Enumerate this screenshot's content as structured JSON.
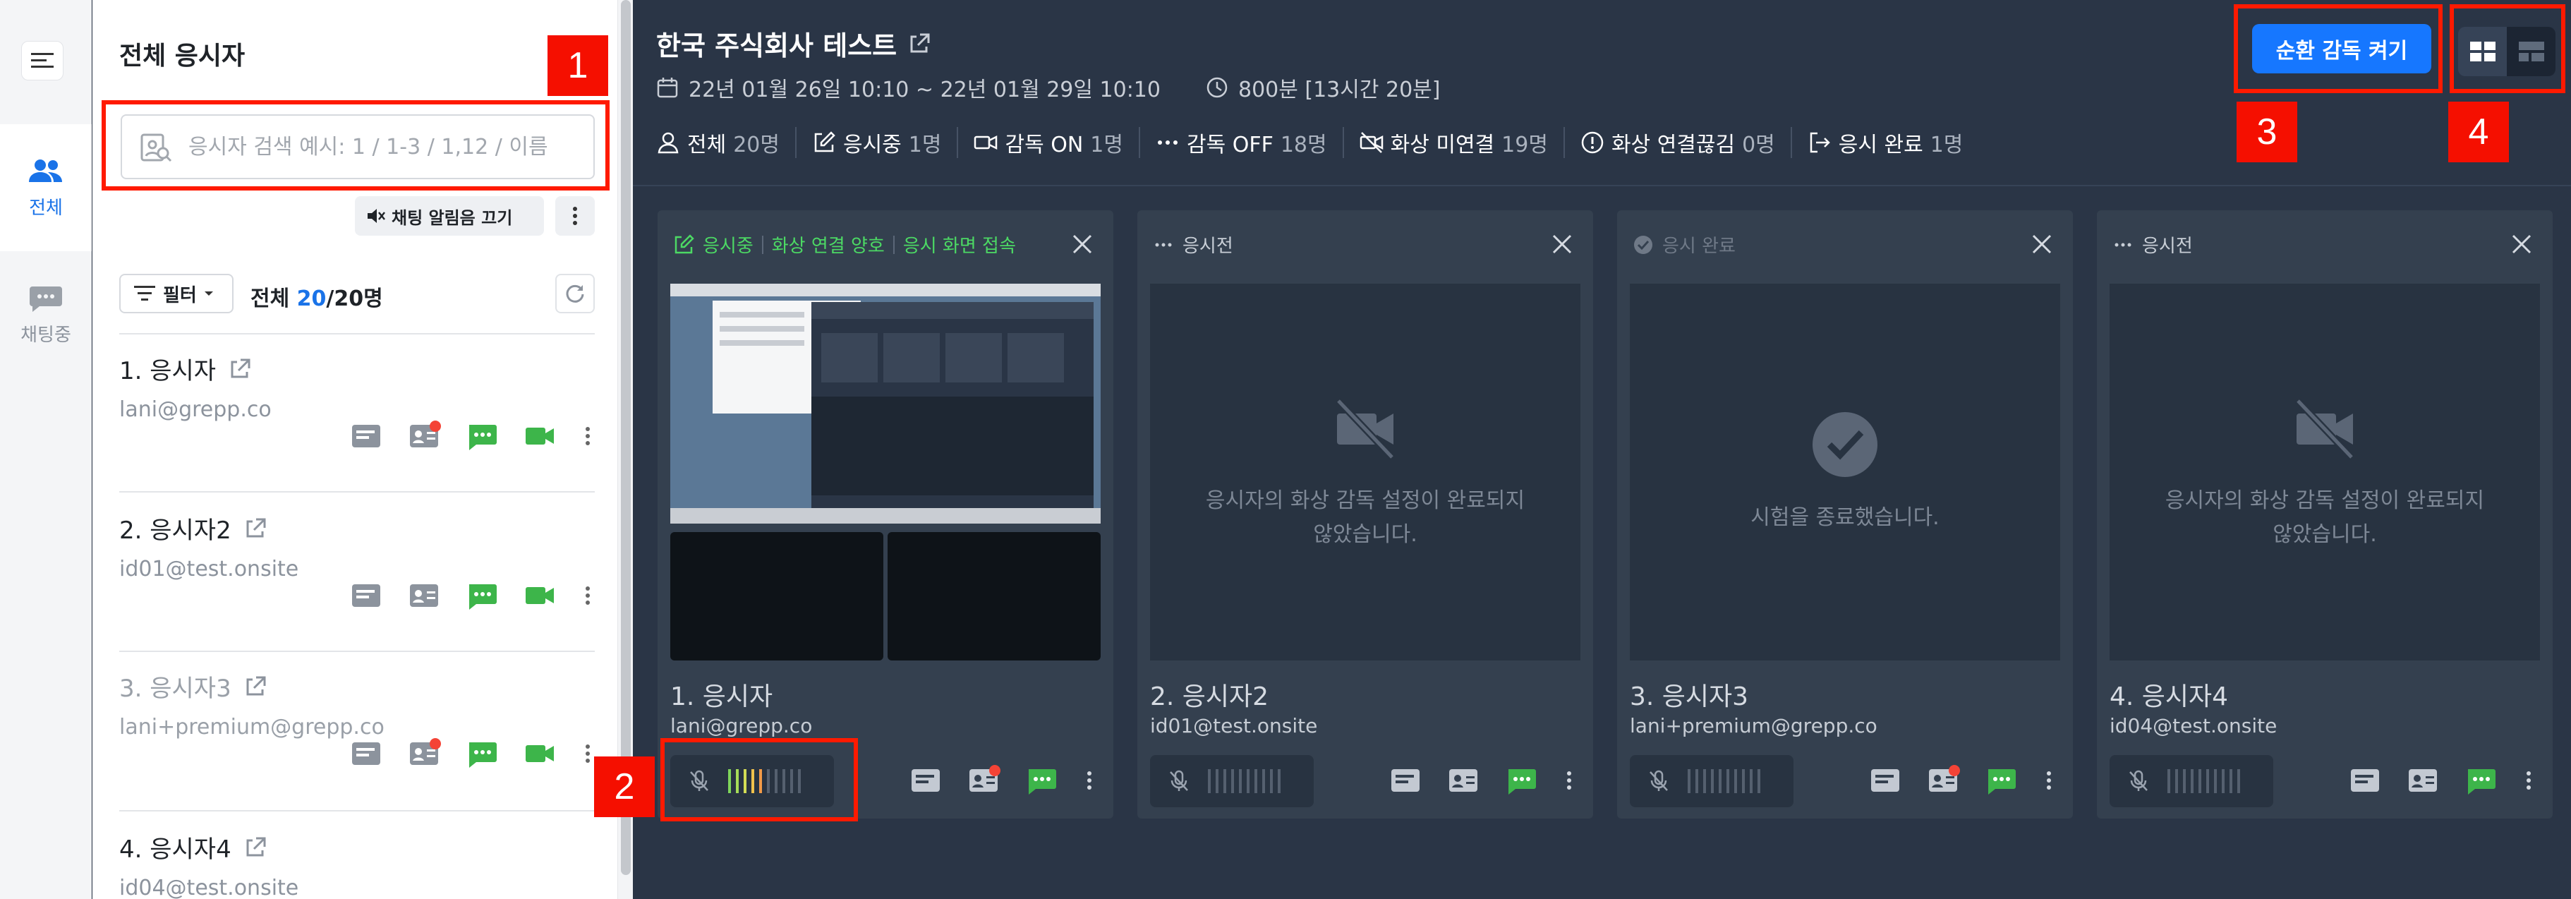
{
  "rail": {
    "tab_all": "전체",
    "tab_chat": "채팅중"
  },
  "panel": {
    "title": "전체 응시자",
    "search_placeholder": "응시자 검색 예시: 1 / 1-3 / 1,12 / 이름",
    "mute_label": "채팅 알림음 끄기",
    "filter_label": "필터",
    "count_prefix": "전체",
    "count_current": "20",
    "count_total": "/20명"
  },
  "participants": [
    {
      "name": "1. 응시자",
      "email": "lani@grepp.co"
    },
    {
      "name": "2. 응시자2",
      "email": "id01@test.onsite"
    },
    {
      "name": "3. 응시자3",
      "email": "lani+premium@grepp.co"
    },
    {
      "name": "4. 응시자4",
      "email": "id04@test.onsite"
    }
  ],
  "header": {
    "title": "한국 주식회사 테스트",
    "period": "22년 01월 26일 10:10 ~ 22년 01월 29일 10:10",
    "duration": "800분 [13시간 20분]",
    "rotate_button": "순환 감독 켜기"
  },
  "stats": [
    {
      "label": "전체",
      "value": "20명",
      "icon": "person-icon"
    },
    {
      "label": "응시중",
      "value": "1명",
      "icon": "edit-icon"
    },
    {
      "label": "감독 ON",
      "value": "1명",
      "icon": "video-icon"
    },
    {
      "label": "감독 OFF",
      "value": "18명",
      "icon": "ellipsis-icon"
    },
    {
      "label": "화상 미연결",
      "value": "19명",
      "icon": "video-off-icon"
    },
    {
      "label": "화상 연결끊김",
      "value": "0명",
      "icon": "alert-icon"
    },
    {
      "label": "응시 완료",
      "value": "1명",
      "icon": "exit-icon"
    }
  ],
  "cards": [
    {
      "status_1": "응시중",
      "status_2": "화상 연결 양호",
      "status_3": "응시 화면 접속",
      "name": "1. 응시자",
      "email": "lani@grepp.co"
    },
    {
      "status_1": "응시전",
      "message": "응시자의 화상 감독 설정이 완료되지 않았습니다.",
      "name": "2. 응시자2",
      "email": "id01@test.onsite"
    },
    {
      "status_1": "응시 완료",
      "message": "시험을 종료했습니다.",
      "name": "3. 응시자3",
      "email": "lani+premium@grepp.co"
    },
    {
      "status_1": "응시전",
      "message": "응시자의 화상 감독 설정이 완료되지 않았습니다.",
      "name": "4. 응시자4",
      "email": "id04@test.onsite"
    }
  ],
  "callouts": [
    "1",
    "2",
    "3",
    "4"
  ],
  "colors": {
    "accent": "#1677ff",
    "status_ok": "#4cd964",
    "callout": "#ff1a00",
    "background": "#2a3546"
  }
}
